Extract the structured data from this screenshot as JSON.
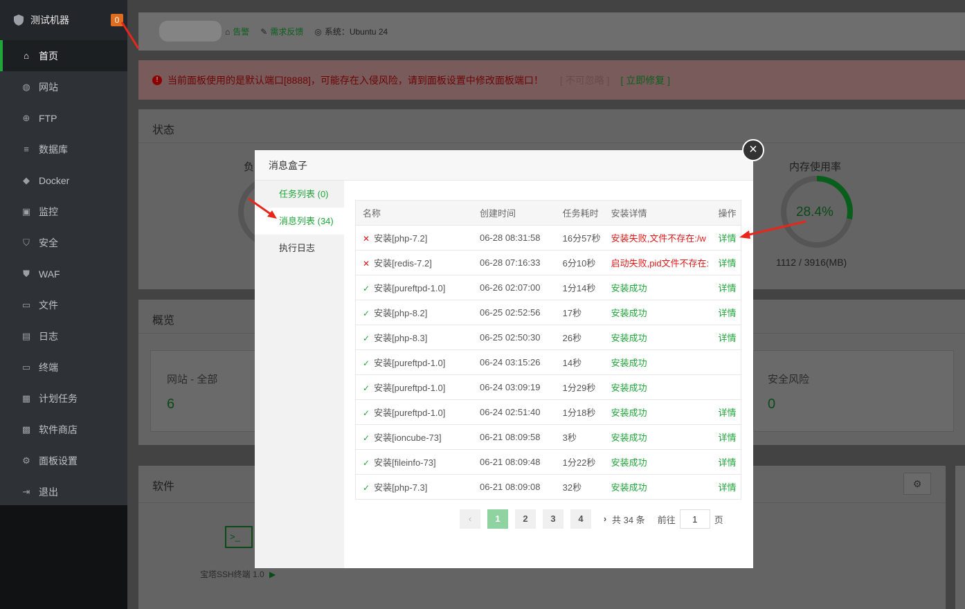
{
  "sidebar": {
    "title": "测试机器",
    "badge": "0",
    "items": [
      {
        "label": "首页",
        "icon": "home-icon"
      },
      {
        "label": "网站",
        "icon": "globe-icon"
      },
      {
        "label": "FTP",
        "icon": "ftp-icon"
      },
      {
        "label": "数据库",
        "icon": "database-icon"
      },
      {
        "label": "Docker",
        "icon": "docker-icon"
      },
      {
        "label": "监控",
        "icon": "monitor-icon"
      },
      {
        "label": "安全",
        "icon": "shield-icon"
      },
      {
        "label": "WAF",
        "icon": "waf-icon"
      },
      {
        "label": "文件",
        "icon": "folder-icon"
      },
      {
        "label": "日志",
        "icon": "log-icon"
      },
      {
        "label": "终端",
        "icon": "terminal-icon"
      },
      {
        "label": "计划任务",
        "icon": "calendar-icon"
      },
      {
        "label": "软件商店",
        "icon": "apps-icon"
      },
      {
        "label": "面板设置",
        "icon": "gear-icon"
      },
      {
        "label": "退出",
        "icon": "logout-icon"
      }
    ]
  },
  "topbar": {
    "alarm": "告警",
    "feedback": "需求反馈",
    "system": "系统：Ubuntu 24"
  },
  "alert": {
    "message": "当前面板使用的是默认端口[8888]，可能存在入侵风险，请到面板设置中修改面板端口！",
    "ignore": "[ 不可忽略 ]",
    "fix": "[ 立即修复 ]"
  },
  "status_panel": {
    "title": "状态",
    "load_label_partial": "负",
    "memory_label": "内存使用率",
    "memory_percent": "28.4%",
    "memory_value": 28.4,
    "memory_detail": "1112 / 3916(MB)"
  },
  "overview": {
    "title": "概览",
    "site_label": "网站 - 全部",
    "site_count": "6",
    "risk_label": "安全风险",
    "risk_count": "0"
  },
  "software": {
    "title": "软件",
    "item_name": "宝塔SSH终端 1.0"
  },
  "modal": {
    "title": "消息盒子",
    "close": "×",
    "tabs": [
      "任务列表 (0)",
      "消息列表 (34)",
      "执行日志"
    ],
    "table": {
      "headers": [
        "名称",
        "创建时间",
        "任务耗时",
        "安装详情",
        "操作"
      ],
      "rows": [
        {
          "status": "fail",
          "name": "安装[php-7.2]",
          "time": "06-28 08:31:58",
          "duration": "16分57秒",
          "detail": "安装失败,文件不存在:/w",
          "op": "详情"
        },
        {
          "status": "fail",
          "name": "安装[redis-7.2]",
          "time": "06-28 07:16:33",
          "duration": "6分10秒",
          "detail": "启动失败,pid文件不存在:",
          "op": "详情"
        },
        {
          "status": "ok",
          "name": "安装[pureftpd-1.0]",
          "time": "06-26 02:07:00",
          "duration": "1分14秒",
          "detail": "安装成功",
          "op": "详情"
        },
        {
          "status": "ok",
          "name": "安装[php-8.2]",
          "time": "06-25 02:52:56",
          "duration": "17秒",
          "detail": "安装成功",
          "op": "详情"
        },
        {
          "status": "ok",
          "name": "安装[php-8.3]",
          "time": "06-25 02:50:30",
          "duration": "26秒",
          "detail": "安装成功",
          "op": "详情"
        },
        {
          "status": "ok",
          "name": "安装[pureftpd-1.0]",
          "time": "06-24 03:15:26",
          "duration": "14秒",
          "detail": "安装成功",
          "op": ""
        },
        {
          "status": "ok",
          "name": "安装[pureftpd-1.0]",
          "time": "06-24 03:09:19",
          "duration": "1分29秒",
          "detail": "安装成功",
          "op": ""
        },
        {
          "status": "ok",
          "name": "安装[pureftpd-1.0]",
          "time": "06-24 02:51:40",
          "duration": "1分18秒",
          "detail": "安装成功",
          "op": "详情"
        },
        {
          "status": "ok",
          "name": "安装[ioncube-73]",
          "time": "06-21 08:09:58",
          "duration": "3秒",
          "detail": "安装成功",
          "op": "详情"
        },
        {
          "status": "ok",
          "name": "安装[fileinfo-73]",
          "time": "06-21 08:09:48",
          "duration": "1分22秒",
          "detail": "安装成功",
          "op": "详情"
        },
        {
          "status": "ok",
          "name": "安装[php-7.3]",
          "time": "06-21 08:09:08",
          "duration": "32秒",
          "detail": "安装成功",
          "op": "详情"
        }
      ]
    },
    "pager": {
      "prev": "‹",
      "pages": [
        "1",
        "2",
        "3",
        "4"
      ],
      "next": "›",
      "total": "共 34 条",
      "goto_label": "前往",
      "goto_value": "1",
      "page_suffix": "页"
    }
  }
}
